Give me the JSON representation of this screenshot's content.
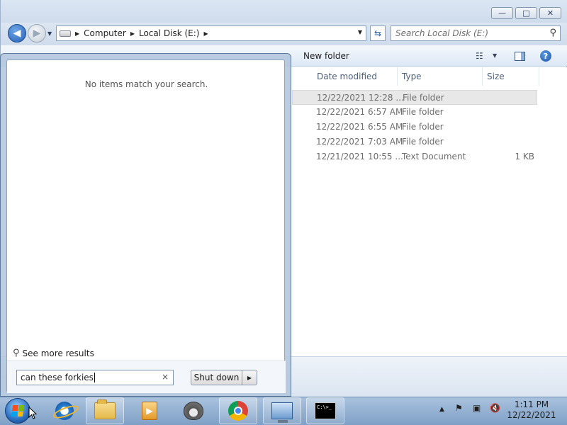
{
  "explorer": {
    "window_buttons": {
      "minimize": "—",
      "maximize": "□",
      "close": "✕"
    },
    "breadcrumb": [
      "Computer",
      "Local Disk (E:)"
    ],
    "search_placeholder": "Search Local Disk (E:)",
    "toolbar": {
      "new_folder": "New folder"
    },
    "columns": {
      "date": "Date modified",
      "type": "Type",
      "size": "Size"
    },
    "rows": [
      {
        "date": "12/22/2021 12:28 ...",
        "type": "File folder",
        "size": "",
        "selected": true
      },
      {
        "date": "12/22/2021 6:57 AM",
        "type": "File folder",
        "size": ""
      },
      {
        "date": "12/22/2021 6:55 AM",
        "type": "File folder",
        "size": ""
      },
      {
        "date": "12/22/2021 7:03 AM",
        "type": "File folder",
        "size": ""
      },
      {
        "date": "12/21/2021 10:55 ...",
        "type": "Text Document",
        "size": "1 KB"
      }
    ]
  },
  "start_menu": {
    "no_items": "No items match your search.",
    "see_more": "See more results",
    "search_value": "can these forkies",
    "clear": "×",
    "shutdown_label": "Shut down"
  },
  "taskbar": {
    "clock_time": "1:11 PM",
    "clock_date": "12/22/2021",
    "pinned_apps": [
      "internet-explorer-icon",
      "windows-explorer-icon",
      "media-player-icon",
      "raccoon-app-icon",
      "chrome-icon",
      "network-computer-icon",
      "command-prompt-icon"
    ],
    "cmd_text": "C:\\>_"
  },
  "colors": {
    "taskbar": "#8fadd2",
    "selected_row": "#e8e8e8",
    "link_blue": "#2560b8"
  }
}
